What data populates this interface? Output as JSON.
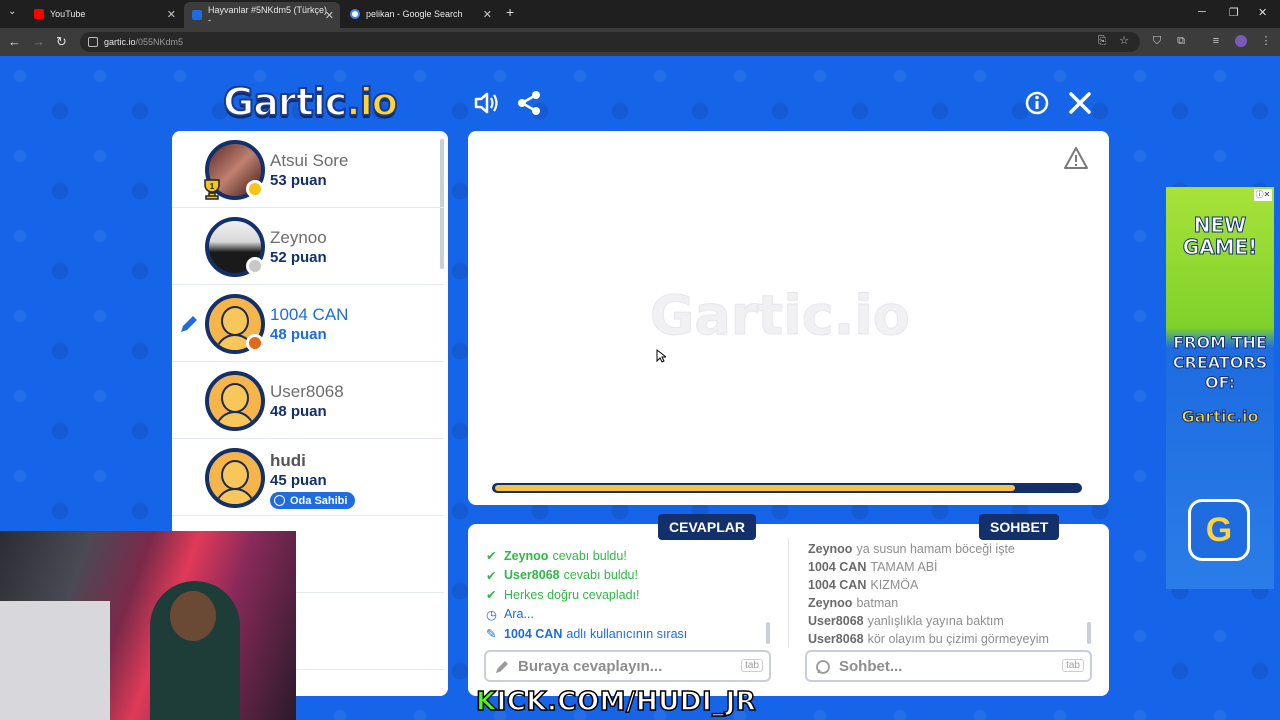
{
  "browser": {
    "tabs": [
      {
        "title": "YouTube",
        "favicon_color": "#ff0000"
      },
      {
        "title": "Hayvanlar #5NKdm5 (Türkçe) -",
        "favicon_color": "#1e6ce0"
      },
      {
        "title": "pelikan - Google Search",
        "favicon_color": "#4285f4"
      }
    ],
    "url_host": "gartic.io",
    "url_path": "/055NKdm5"
  },
  "game": {
    "logo_main": "Gartic",
    "logo_suffix": ".io",
    "watermark": "Gartic.io",
    "timer_progress": 0.89,
    "players": [
      {
        "name": "Atsui Sore",
        "score": "53 puan",
        "dot_color": "#f5c518",
        "rank": "1",
        "avatar": "photo1"
      },
      {
        "name": "Zeynoo",
        "score": "52 puan",
        "dot_color": "#c8c8c8",
        "avatar": "photo2"
      },
      {
        "name": "1004 CAN",
        "score": "48 puan",
        "dot_color": "#e06a1a",
        "avatar": "default",
        "drawing": true
      },
      {
        "name": "User8068",
        "score": "48 puan",
        "avatar": "default"
      },
      {
        "name": "hudi",
        "score": "45 puan",
        "avatar": "default",
        "owner_badge": "Oda Sahibi"
      }
    ],
    "answers_header": "CEVAPLAR",
    "chat_header": "SOHBET",
    "answers": [
      {
        "name": "Zeynoo",
        "text": "cevabı buldu!",
        "type": "found"
      },
      {
        "name": "User8068",
        "text": "cevabı buldu!",
        "type": "found"
      },
      {
        "name": "",
        "text": "Herkes doğru cevapladı!",
        "type": "found"
      },
      {
        "name": "",
        "text": "Ara...",
        "type": "info"
      },
      {
        "name": "1004 CAN",
        "text": "adlı kullanıcının sırası",
        "type": "turn"
      }
    ],
    "chat": [
      {
        "name": "Zeynoo",
        "text": "ya susun hamam böceği işte"
      },
      {
        "name": "1004 CAN",
        "text": "TAMAM ABİ"
      },
      {
        "name": "1004 CAN",
        "text": "KIZMÖA"
      },
      {
        "name": "Zeynoo",
        "text": "batman"
      },
      {
        "name": "User8068",
        "text": "yanlışlıkla yayına baktım"
      },
      {
        "name": "User8068",
        "text": "kör olayım bu çizimi görmeyeyim"
      }
    ],
    "answer_placeholder": "Buraya cevaplayın...",
    "chat_placeholder": "Sohbet...",
    "tab_hint": "tab"
  },
  "ad": {
    "line1": "NEW",
    "line2": "GAME!",
    "line3": "FROM THE",
    "line4": "CREATORS",
    "line5": "OF:",
    "brand": "Gartic.io",
    "button": "G"
  },
  "overlay": {
    "kick_prefix": "K",
    "kick_rest": "ICK.COM/HUDI_JR"
  }
}
